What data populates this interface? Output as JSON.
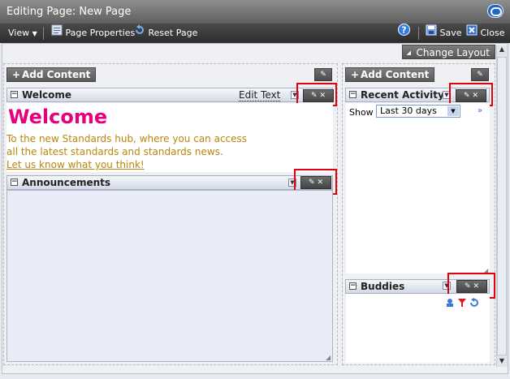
{
  "titlebar": {
    "prefix": "Editing Page:",
    "page_name": "New Page"
  },
  "toolbar": {
    "view": "View",
    "page_properties": "Page Properties",
    "reset_page": "Reset Page",
    "save": "Save",
    "close": "Close"
  },
  "layout": {
    "change_layout": "Change Layout"
  },
  "left_column": {
    "add_content": "Add Content",
    "welcome": {
      "title": "Welcome",
      "edit_text": "Edit Text",
      "heading": "Welcome",
      "line1": "To the new Standards hub, where you can access",
      "line2": "all the latest standards and standards news.",
      "link": "Let us know what you think!"
    },
    "announcements": {
      "title": "Announcements"
    }
  },
  "right_column": {
    "add_content": "Add Content",
    "recent_activity": {
      "title": "Recent Activity",
      "show_label": "Show",
      "selected": "Last 30 days"
    },
    "buddies": {
      "title": "Buddies"
    }
  },
  "colors": {
    "highlight": "#e2000f",
    "welcome_heading": "#e6007e",
    "welcome_text": "#b8860b"
  }
}
